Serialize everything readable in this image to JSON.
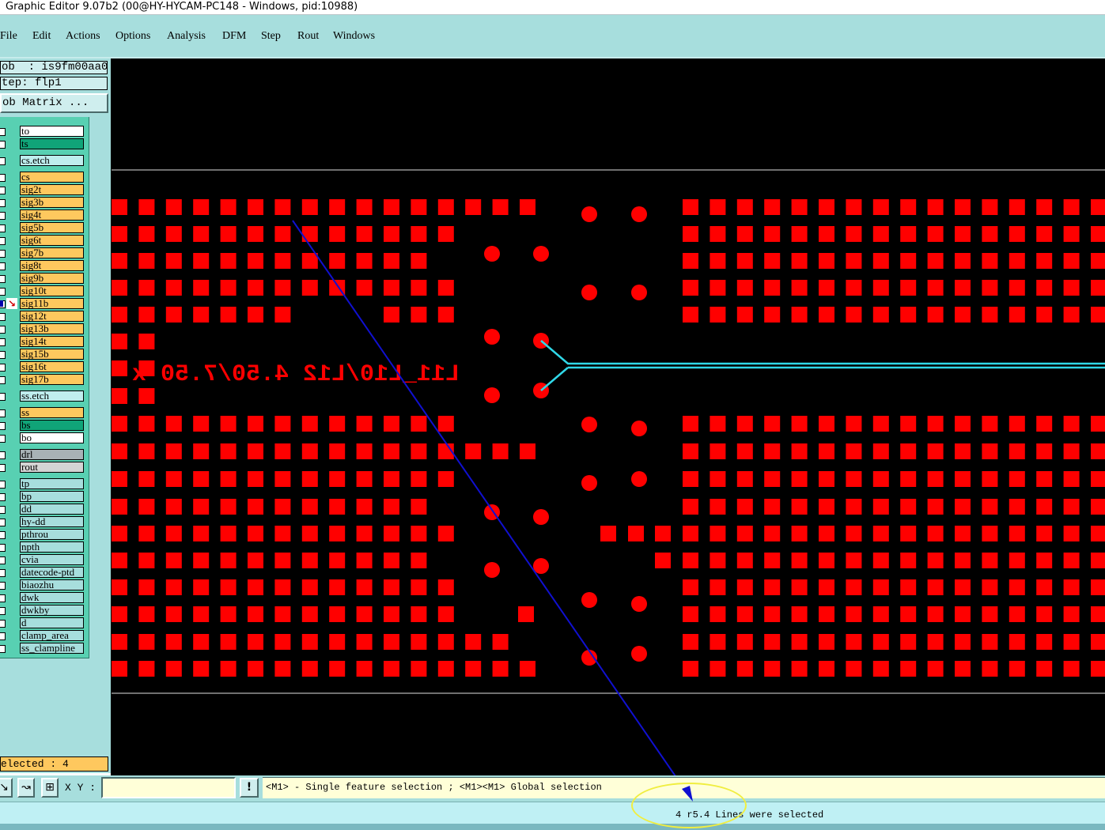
{
  "window": {
    "title": "Graphic Editor 9.07b2 (00@HY-HYCAM-PC148 - Windows, pid:10988)"
  },
  "menu": [
    "File",
    "Edit",
    "Actions",
    "Options",
    "Analysis",
    "DFM",
    "Step",
    "Rout",
    "Windows"
  ],
  "job": {
    "job_line": "ob  : is9fm00aa0",
    "step_line": "tep: flp1",
    "matrix_button": "ob Matrix ..."
  },
  "layers": [
    {
      "name": "to",
      "color": "#ffffff"
    },
    {
      "name": "ts",
      "color": "#10a478"
    },
    {
      "name": "cs.etch",
      "color": "#bfeeee"
    },
    {
      "name": "cs",
      "color": "#fec85e"
    },
    {
      "name": "sig2t",
      "color": "#fec85e"
    },
    {
      "name": "sig3b",
      "color": "#fec85e"
    },
    {
      "name": "sig4t",
      "color": "#fec85e"
    },
    {
      "name": "sig5b",
      "color": "#fec85e"
    },
    {
      "name": "sig6t",
      "color": "#fec85e"
    },
    {
      "name": "sig7b",
      "color": "#fec85e"
    },
    {
      "name": "sig8t",
      "color": "#fec85e"
    },
    {
      "name": "sig9b",
      "color": "#fec85e"
    },
    {
      "name": "sig10t",
      "color": "#fec85e"
    },
    {
      "name": "sig11b",
      "color": "#fec85e",
      "marked": true
    },
    {
      "name": "sig12t",
      "color": "#fec85e"
    },
    {
      "name": "sig13b",
      "color": "#fec85e"
    },
    {
      "name": "sig14t",
      "color": "#fec85e"
    },
    {
      "name": "sig15b",
      "color": "#fec85e"
    },
    {
      "name": "sig16t",
      "color": "#fec85e"
    },
    {
      "name": "sig17b",
      "color": "#fec85e"
    },
    {
      "name": "ss.etch",
      "color": "#bfeeee"
    },
    {
      "name": "ss",
      "color": "#fec85e"
    },
    {
      "name": "bs",
      "color": "#10a478"
    },
    {
      "name": "bo",
      "color": "#ffffff"
    },
    {
      "name": "drl",
      "color": "#a8b2b6"
    },
    {
      "name": "rout",
      "color": "#d4d4d4"
    },
    {
      "name": "tp",
      "color": "#a7dedd"
    },
    {
      "name": "bp",
      "color": "#a7dedd"
    },
    {
      "name": "dd",
      "color": "#a7dedd"
    },
    {
      "name": "hy-dd",
      "color": "#a7dedd"
    },
    {
      "name": "pthrou",
      "color": "#a7dedd"
    },
    {
      "name": "npth",
      "color": "#a7dedd"
    },
    {
      "name": "cvia",
      "color": "#a7dedd"
    },
    {
      "name": "datecode-ptd",
      "color": "#a7dedd"
    },
    {
      "name": "biaozhu",
      "color": "#a7dedd"
    },
    {
      "name": "dwk",
      "color": "#a7dedd"
    },
    {
      "name": "dwkby",
      "color": "#a7dedd"
    },
    {
      "name": "d",
      "color": "#a7dedd"
    },
    {
      "name": "clamp_area",
      "color": "#a7dedd"
    },
    {
      "name": "ss_clampline",
      "color": "#a7dedd"
    }
  ],
  "selected_count": "elected : 4",
  "canvas": {
    "text_label": "L11_L10/L12 4.50/7.50 x"
  },
  "toolbar": {
    "xy_label": "X Y :",
    "xy_value": "",
    "info_button": "!"
  },
  "message": "<M1> - Single feature selection ; <M1><M1> Global selection",
  "status": "4 r5.4 Lines were selected",
  "colors": {
    "background": "#000000",
    "pads": "#ff0000",
    "trace": "#30d8e8",
    "pointer_line": "#1010d0",
    "highlight": "#f0ee40",
    "panel": "#a7dedd"
  }
}
